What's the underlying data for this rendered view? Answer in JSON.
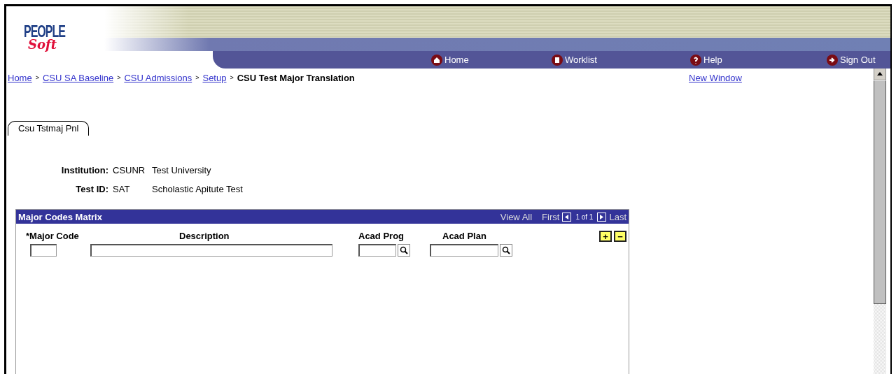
{
  "logo": {
    "line_1": "PEOPLE",
    "line_2": "Soft"
  },
  "nav": [
    {
      "label": "Home",
      "kind": "home"
    },
    {
      "label": "Worklist",
      "kind": "worklist"
    },
    {
      "label": "Help",
      "kind": "help"
    },
    {
      "label": "Sign Out",
      "kind": "signout"
    }
  ],
  "breadcrumb": [
    {
      "label": "Home",
      "link": true
    },
    {
      "label": "CSU SA Baseline",
      "link": true
    },
    {
      "label": "CSU Admissions",
      "link": true
    },
    {
      "label": "Setup",
      "link": true
    },
    {
      "label": "CSU Test Major Translation",
      "link": false
    }
  ],
  "breadcrumb_separator": ">",
  "new_window": "New Window",
  "tabs": [
    {
      "label": "Csu Tstmaj Pnl",
      "selected": true
    }
  ],
  "fields": [
    {
      "label": "Institution:",
      "code": "CSUNR",
      "description": "Test University"
    },
    {
      "label": "Test ID:",
      "code": "SAT",
      "description": "Scholastic Apitute Test"
    }
  ],
  "grid": {
    "title": "Major Codes Matrix",
    "view_all": "View All",
    "first": "First",
    "count": "1 of 1",
    "last": "Last",
    "add": "+",
    "delete": "−",
    "columns": [
      {
        "label": "*Major Code",
        "kind": "code"
      },
      {
        "label": "Description",
        "kind": "text"
      },
      {
        "label": "Acad Prog",
        "kind": "prompt"
      },
      {
        "label": "Acad Plan",
        "kind": "prompt"
      }
    ]
  }
}
